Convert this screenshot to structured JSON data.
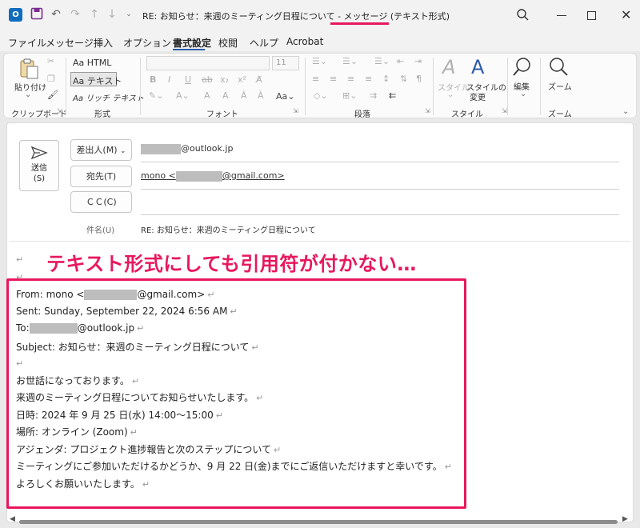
{
  "window": {
    "title": "RE: お知らせ：来週のミーティング日程について  -  メッセージ (テキスト形式)"
  },
  "menu": {
    "tabs": [
      "ファイル",
      "メッセージ",
      "挿入",
      "オプション",
      "書式設定",
      "校閲",
      "ヘルプ",
      "Acrobat"
    ],
    "active_tab": "書式設定"
  },
  "ribbon": {
    "clipboard": {
      "paste": "貼り付け",
      "group": "クリップボード"
    },
    "format": {
      "html": "Aa HTML",
      "text": "Aa テキスト",
      "rich": "Aa リッチ テキスト",
      "group": "形式"
    },
    "font": {
      "size": "11",
      "group": "フォント",
      "case": "Aa"
    },
    "paragraph": {
      "group": "段落"
    },
    "style": {
      "styles": "スタイル",
      "change_style_1": "スタイルの",
      "change_style_2": "変更",
      "group": "スタイル"
    },
    "edit": {
      "edit": "編集"
    },
    "zoom": {
      "zoom": "ズーム",
      "group": "ズーム"
    }
  },
  "compose": {
    "send_label_1": "送信",
    "send_label_2": "(S)",
    "from_button": "差出人(M)",
    "from_value_suffix": "@outlook.jp",
    "to_button": "宛先(T)",
    "to_value_prefix": "mono <",
    "to_value_suffix": "@gmail.com>",
    "cc_button": "ＣＣ(C)",
    "subject_label": "件名(U)",
    "subject_value": "RE: お知らせ：来週のミーティング日程について"
  },
  "annotation": "テキスト形式にしても引用符が付かない…",
  "body_lines": [
    "From: mono <",
    "@gmail.com>",
    "Sent: Sunday, September 22, 2024 6:56 AM",
    "To:",
    "@outlook.jp",
    "Subject: お知らせ：来週のミーティング日程について",
    "お世話になっております。",
    "来週のミーティング日程についてお知らせいたします。",
    "日時: 2024 年 9 月 25 日(水) 14:00～15:00",
    "場所: オンライン (Zoom)",
    "アジェンダ: プロジェクト進捗報告と次のステップについて",
    "ミーティングにご参加いただけるかどうか、9 月 22 日(金)までにご返信いただけますと幸いです。",
    "よろしくお願いいたします。"
  ],
  "colors": {
    "accent": "#e8175d",
    "outlook_blue": "#0f6cbd",
    "active_tab": "#2a5ba8"
  }
}
